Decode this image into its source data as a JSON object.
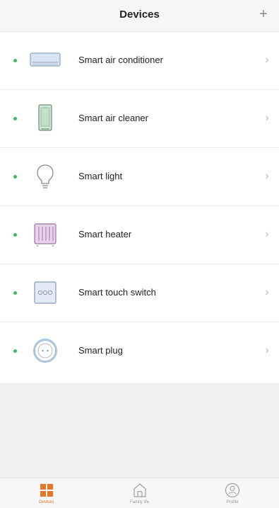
{
  "header": {
    "title": "Devices",
    "add_label": "+"
  },
  "devices": [
    {
      "label": "Smart air conditioner",
      "icon": "air-conditioner-icon",
      "status": "online"
    },
    {
      "label": "Smart air cleaner",
      "icon": "air-cleaner-icon",
      "status": "online"
    },
    {
      "label": "Smart light",
      "icon": "light-bulb-icon",
      "status": "online"
    },
    {
      "label": "Smart heater",
      "icon": "heater-icon",
      "status": "online"
    },
    {
      "label": "Smart touch switch",
      "icon": "touch-switch-icon",
      "status": "online"
    },
    {
      "label": "Smart plug",
      "icon": "plug-icon",
      "status": "online"
    }
  ],
  "chevron": "›",
  "tabs": [
    {
      "label": "Devices",
      "icon": "grid-icon",
      "active": true
    },
    {
      "label": "Family life",
      "icon": "home-icon",
      "active": false
    },
    {
      "label": "Profile",
      "icon": "profile-icon",
      "active": false
    }
  ],
  "colors": {
    "accent": "#e8752a",
    "status_online": "#3dbb5a",
    "background": "#f0eff0"
  }
}
